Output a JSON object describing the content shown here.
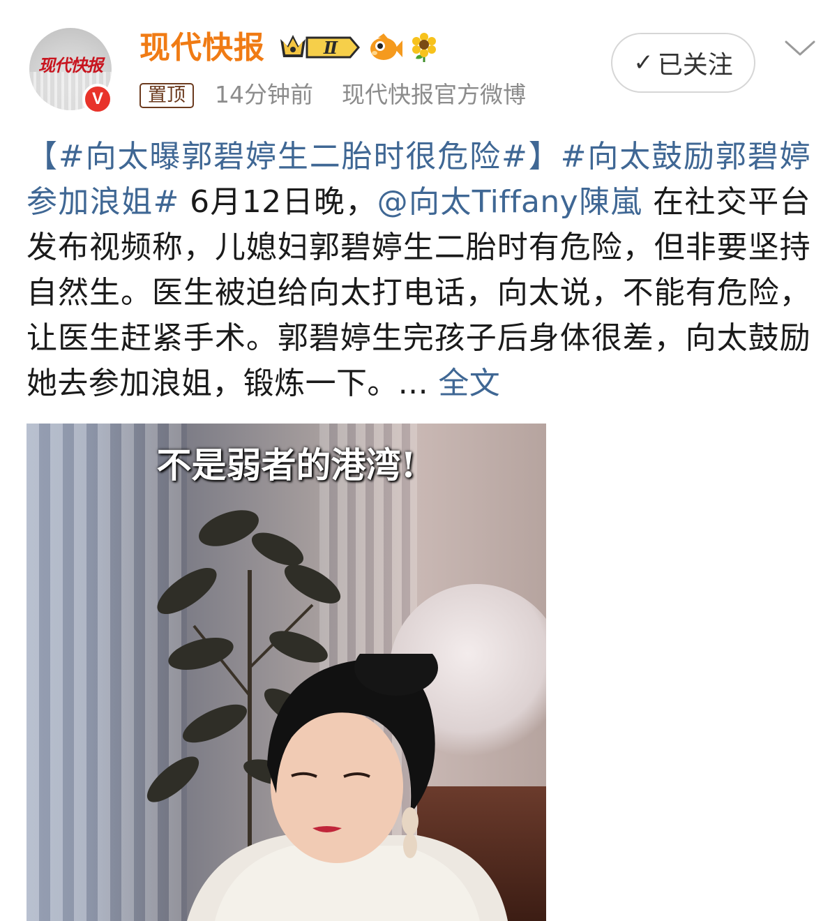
{
  "header": {
    "avatar_logo_text": "现代快报",
    "verified_badge": "V",
    "user_name": "现代快报",
    "vip_level": "Ⅱ",
    "pin_label": "置顶",
    "time_ago": "14分钟前",
    "source": "现代快报官方微博",
    "follow_label": "已关注",
    "follow_check": "✓",
    "accent_color": "#f07b14"
  },
  "post": {
    "topic1": "【#向太曝郭碧婷生二胎时很危险#】",
    "topic2": "#向太鼓励郭碧婷参加浪姐#",
    "text_before_mention": " 6月12日晚，",
    "mention": "@向太Tiffany陳嵐",
    "text_after_mention": " 在社交平台发布视频称，儿媳妇郭碧婷生二胎时有危险，但非要坚持自然生。医生被迫给向太打电话，向太说，不能有危险，让医生赶紧手术。郭碧婷生完孩子后身体很差，向太鼓励她去参加浪姐，锻炼一下。... ",
    "expand_label": "全文",
    "link_color": "#3f6794"
  },
  "media": {
    "subtitle": "不是弱者的港湾!"
  }
}
